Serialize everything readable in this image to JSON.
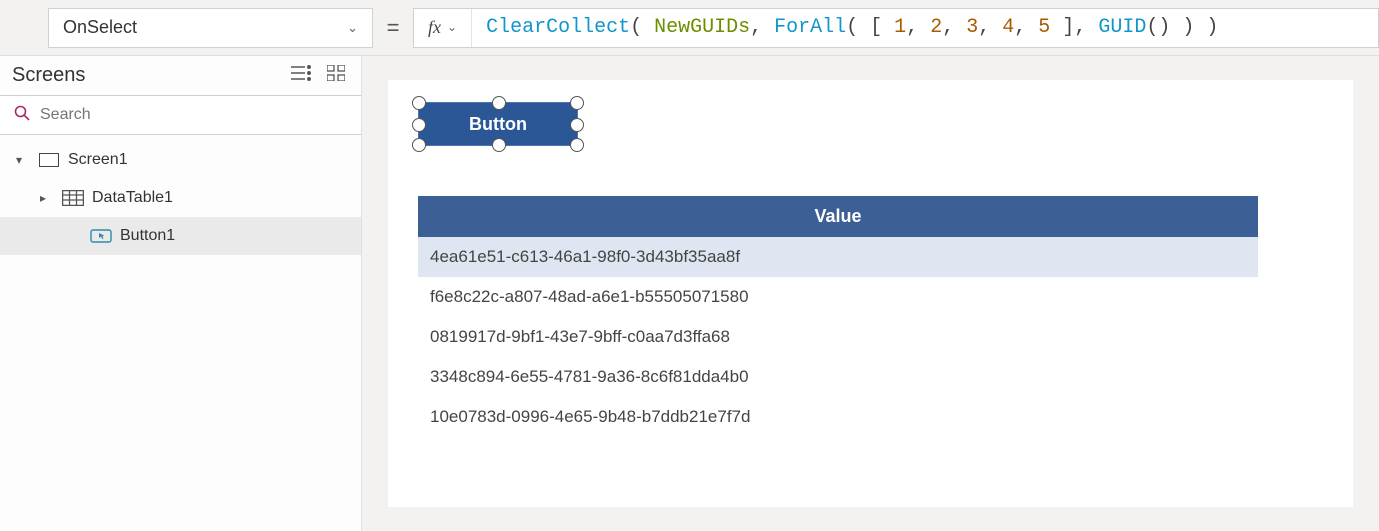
{
  "topbar": {
    "property": "OnSelect",
    "equals": "=",
    "fx_label": "fx",
    "formula_tokens": [
      {
        "t": "func",
        "v": "ClearCollect"
      },
      {
        "t": "punc",
        "v": "( "
      },
      {
        "t": "ident",
        "v": "NewGUIDs"
      },
      {
        "t": "punc",
        "v": ", "
      },
      {
        "t": "func",
        "v": "ForAll"
      },
      {
        "t": "punc",
        "v": "( [ "
      },
      {
        "t": "num",
        "v": "1"
      },
      {
        "t": "punc",
        "v": ", "
      },
      {
        "t": "num",
        "v": "2"
      },
      {
        "t": "punc",
        "v": ", "
      },
      {
        "t": "num",
        "v": "3"
      },
      {
        "t": "punc",
        "v": ", "
      },
      {
        "t": "num",
        "v": "4"
      },
      {
        "t": "punc",
        "v": ", "
      },
      {
        "t": "num",
        "v": "5"
      },
      {
        "t": "punc",
        "v": " ], "
      },
      {
        "t": "func",
        "v": "GUID"
      },
      {
        "t": "punc",
        "v": "() ) )"
      }
    ]
  },
  "left_panel": {
    "title": "Screens",
    "search_placeholder": "Search",
    "tree": [
      {
        "level": 0,
        "caret": "▾",
        "icon": "rect",
        "label": "Screen1",
        "selected": false,
        "collapsible": true
      },
      {
        "level": 1,
        "caret": "▸",
        "icon": "table",
        "label": "DataTable1",
        "selected": false,
        "collapsible": true
      },
      {
        "level": 2,
        "caret": "",
        "icon": "button",
        "label": "Button1",
        "selected": true,
        "collapsible": false
      }
    ]
  },
  "canvas": {
    "button_text": "Button"
  },
  "datatable": {
    "header": "Value",
    "rows": [
      "4ea61e51-c613-46a1-98f0-3d43bf35aa8f",
      "f6e8c22c-a807-48ad-a6e1-b55505071580",
      "0819917d-9bf1-43e7-9bff-c0aa7d3ffa68",
      "3348c894-6e55-4781-9a36-8c6f81dda4b0",
      "10e0783d-0996-4e65-9b48-b7ddb21e7f7d"
    ]
  }
}
